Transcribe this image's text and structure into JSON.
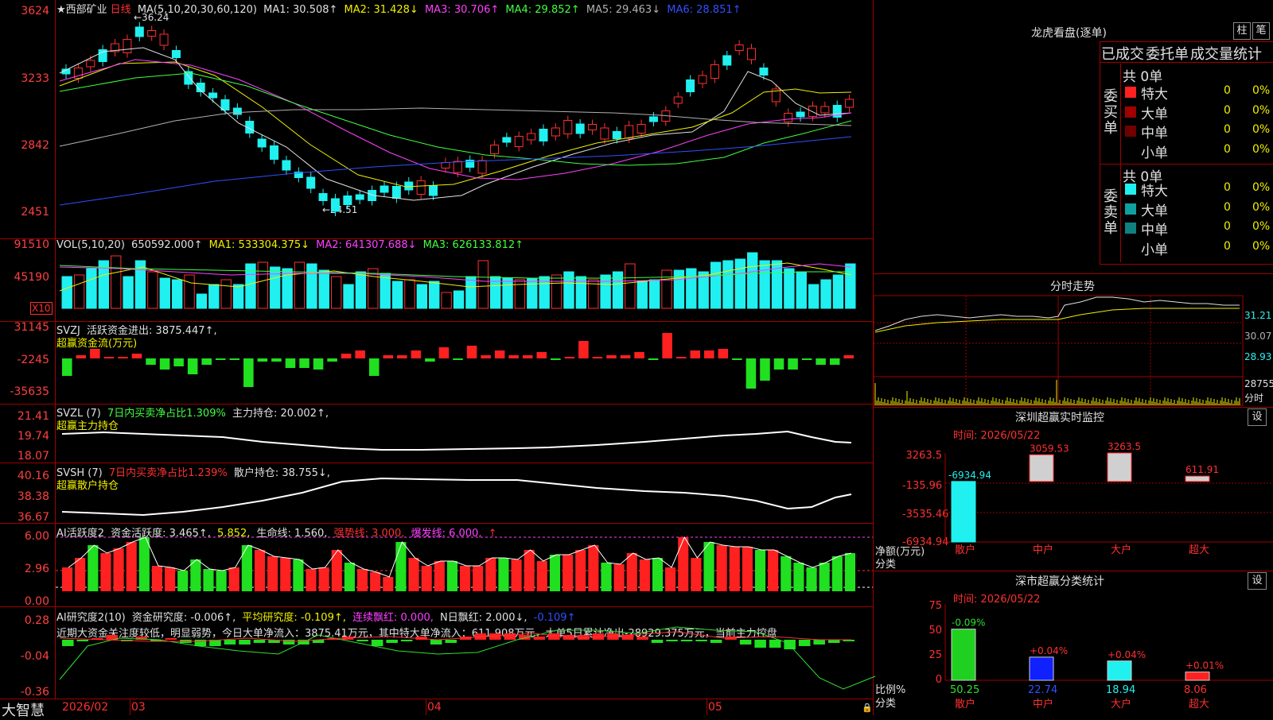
{
  "stock": {
    "name": "★西部矿业",
    "period": "日线"
  },
  "main": {
    "ylabels": [
      "3624",
      "3233",
      "2842",
      "2451"
    ],
    "ma_title": "MA(5,10,20,30,60,120)",
    "ma": [
      {
        "label": "MA1: 30.508↑",
        "color": "#e0e0e0"
      },
      {
        "label": "MA2: 31.428↓",
        "color": "#f0f000"
      },
      {
        "label": "MA3: 30.706↑",
        "color": "#ff40ff"
      },
      {
        "label": "MA4: 29.852↑",
        "color": "#40ff40"
      },
      {
        "label": "MA5: 29.463↓",
        "color": "#b0b0b0"
      },
      {
        "label": "MA6: 28.851↑",
        "color": "#3050ff"
      }
    ],
    "high_note": "←36.24",
    "low_note": "←24.51"
  },
  "vol": {
    "ylabels": [
      "91510",
      "45190"
    ],
    "unit": "X10",
    "title": "VOL(5,10,20)",
    "v": "650592.000↑",
    "ma": [
      {
        "label": "MA1: 533304.375↓",
        "color": "#f0f000"
      },
      {
        "label": "MA2: 641307.688↓",
        "color": "#ff40ff"
      },
      {
        "label": "MA3: 626133.812↑",
        "color": "#40ff40"
      }
    ]
  },
  "svzj": {
    "ylabels": [
      "31145",
      "-2245",
      "-35635"
    ],
    "title": "SVZJ",
    "l1": "活跃资金进出: 3875.447↑,",
    "l2": "超赢资金流(万元)"
  },
  "svzl": {
    "ylabels": [
      "21.41",
      "19.74",
      "18.07"
    ],
    "title": "SVZL (7)",
    "pct": "7日内买卖净占比1.309%",
    "hold": "主力持仓: 20.002↑,",
    "l2": "超赢主力持仓"
  },
  "svsh": {
    "ylabels": [
      "40.16",
      "38.38",
      "36.67"
    ],
    "title": "SVSH (7)",
    "pct": "7日内买卖净占比1.239%",
    "hold": "散户持仓: 38.755↓,",
    "l2": "超赢散户持仓"
  },
  "ai1": {
    "ylabels": [
      "6.00",
      "2.96",
      "0.00"
    ],
    "title": "AI活跃度2",
    "a": "资金活跃度: 3.465↑,",
    "b": "5.852,",
    "c": "生命线: 1.560,",
    "d": "强势线: 3.000,",
    "e": "爆发线: 6.000,",
    "arrow": "↑"
  },
  "ai2": {
    "ylabels": [
      "0.28",
      "-0.04",
      "-0.36"
    ],
    "title": "AI研究度2(10)",
    "a": "资金研究度: -0.006↑,",
    "b": "平均研究度: -0.109↑,",
    "c": "连续飘红: 0.000,",
    "d": "N日飘红: 2.000↓,",
    "e": "-0.109↑",
    "comment": "近期大资金关注度较低，明显弱势，今日大单净流入：3875.41万元，其中特大单净流入：611.908万元，大单5日累计净出-28929.375万元，当前主力控盘"
  },
  "bottom": {
    "brand": "大智慧",
    "dates": [
      "2026/02",
      "03",
      "04",
      "05"
    ]
  },
  "lhb": {
    "title": "龙虎看盘(逐单)",
    "btn1": "柱",
    "btn2": "笔",
    "tabs": [
      "已成交",
      "委托单",
      "成交量统计"
    ],
    "buy": {
      "label": "委买单",
      "count": "共 0单",
      "rows": [
        {
          "name": "特大",
          "n": "0",
          "p": "0%",
          "color": "#ff2020"
        },
        {
          "name": "大单",
          "n": "0",
          "p": "0%",
          "color": "#a00000"
        },
        {
          "name": "中单",
          "n": "0",
          "p": "0%",
          "color": "#700000"
        },
        {
          "name": "小单",
          "n": "0",
          "p": "0%",
          "color": "#000000"
        }
      ]
    },
    "sell": {
      "label": "委卖单",
      "count": "共 0单",
      "rows": [
        {
          "name": "特大",
          "n": "0",
          "p": "0%",
          "color": "#20f0f0"
        },
        {
          "name": "大单",
          "n": "0",
          "p": "0%",
          "color": "#10a0a0"
        },
        {
          "name": "中单",
          "n": "0",
          "p": "0%",
          "color": "#108080"
        },
        {
          "name": "小单",
          "n": "0",
          "p": "0%",
          "color": "#000000"
        }
      ]
    }
  },
  "fenshi": {
    "title": "分时走势",
    "y": [
      "31.21",
      "30.07",
      "28.93"
    ],
    "vol": "28755",
    "unit": "分时"
  },
  "monitor": {
    "title": "深圳超赢实时监控",
    "btn": "设",
    "time": "时间: 2026/05/22",
    "y": [
      "3263.5",
      "-135.96",
      "-3535.46",
      "-6934.94"
    ],
    "ylab1": "净额(万元)",
    "ylab2": "分类",
    "cats": [
      "散户",
      "中户",
      "大户",
      "超大"
    ],
    "values": [
      -6934.94,
      3059.53,
      3263.5,
      611.91
    ],
    "labels": [
      "-6934.94",
      "3059.53",
      "3263.5",
      "611.91"
    ]
  },
  "stat": {
    "title": "深市超赢分类统计",
    "btn": "设",
    "time": "时间: 2026/05/22",
    "y": [
      "75",
      "50",
      "25",
      "0"
    ],
    "ylab1": "比例%",
    "ylab2": "分类",
    "cats": [
      "散户",
      "中户",
      "大户",
      "超大"
    ],
    "values": [
      50.25,
      22.74,
      18.94,
      8.06
    ],
    "labels": [
      "50.25",
      "22.74",
      "18.94",
      "8.06"
    ],
    "changes": [
      "-0.09%",
      "+0.04%",
      "+0.04%",
      "+0.01%"
    ]
  }
}
